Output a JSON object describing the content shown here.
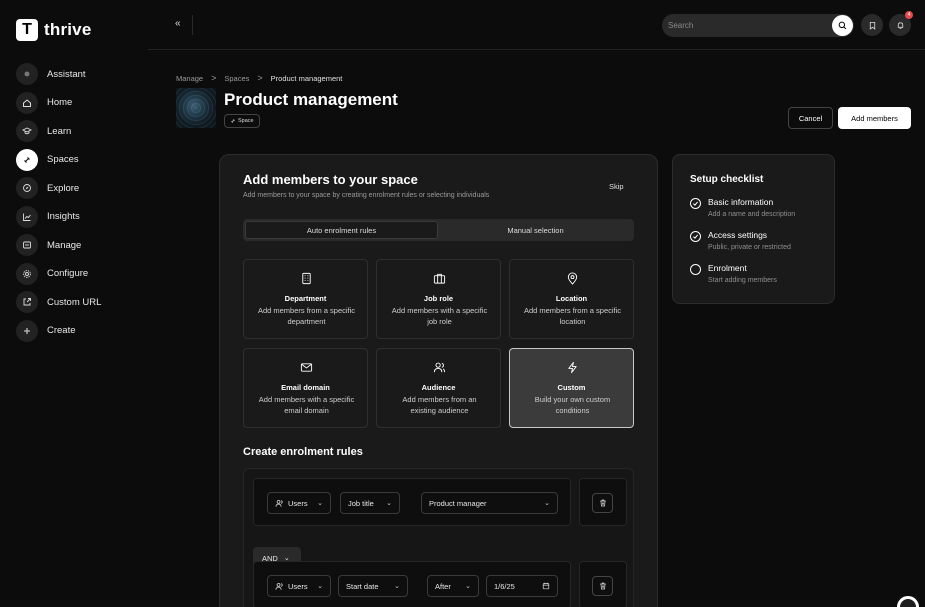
{
  "app": {
    "logo_letter": "T",
    "name": "thrive"
  },
  "sidebar": {
    "items": [
      {
        "label": "Assistant",
        "icon": "sparkle-icon"
      },
      {
        "label": "Home",
        "icon": "home-icon"
      },
      {
        "label": "Learn",
        "icon": "graduation-cap-icon"
      },
      {
        "label": "Spaces",
        "icon": "spaces-icon",
        "active": true
      },
      {
        "label": "Explore",
        "icon": "compass-icon"
      },
      {
        "label": "Insights",
        "icon": "chart-icon"
      },
      {
        "label": "Manage",
        "icon": "manage-icon"
      },
      {
        "label": "Configure",
        "icon": "gear-icon"
      },
      {
        "label": "Custom URL",
        "icon": "external-link-icon"
      },
      {
        "label": "Create",
        "icon": "plus-icon"
      }
    ]
  },
  "topbar": {
    "collapse_glyph": "«",
    "search_placeholder": "Search",
    "notification_count": "4"
  },
  "breadcrumb": {
    "items": [
      "Manage",
      "Spaces",
      "Product management"
    ],
    "sep": ">"
  },
  "page": {
    "title": "Product management",
    "chip": "Space",
    "cancel_label": "Cancel",
    "add_members_label": "Add members"
  },
  "card": {
    "title": "Add members to your space",
    "subtitle": "Add members to your space by creating enrolment rules or selecting individuals",
    "skip_label": "Skip",
    "tabs": [
      "Auto enrolment rules",
      "Manual selection"
    ],
    "options": [
      {
        "title": "Department",
        "desc": "Add members from a specific department",
        "icon": "building-icon"
      },
      {
        "title": "Job role",
        "desc": "Add members with a specific job role",
        "icon": "briefcase-icon"
      },
      {
        "title": "Location",
        "desc": "Add members from a specific location",
        "icon": "map-pin-icon"
      },
      {
        "title": "Email domain",
        "desc": "Add members with a specific email domain",
        "icon": "mail-icon"
      },
      {
        "title": "Audience",
        "desc": "Add members from an existing audience",
        "icon": "users-icon"
      },
      {
        "title": "Custom",
        "desc": "Build your own custom conditions",
        "icon": "lightning-icon",
        "selected": true
      }
    ],
    "rules_title": "Create enrolment rules",
    "rules": [
      {
        "subject": "Users",
        "field": "Job title",
        "value": "Product manager"
      },
      {
        "subject": "Users",
        "field": "Start date",
        "operator": "After",
        "date": "1/6/25"
      }
    ],
    "and_label": "AND"
  },
  "checklist": {
    "title": "Setup checklist",
    "items": [
      {
        "name": "Basic information",
        "desc": "Add a name and description",
        "done": true
      },
      {
        "name": "Access settings",
        "desc": "Public, private or restricted",
        "done": true
      },
      {
        "name": "Enrolment",
        "desc": "Start adding members",
        "done": false
      }
    ]
  },
  "colors": {
    "background": "#0c0c0c",
    "card": "#1a1a1a",
    "accent": "#ffffff",
    "badge": "#e5484d"
  }
}
